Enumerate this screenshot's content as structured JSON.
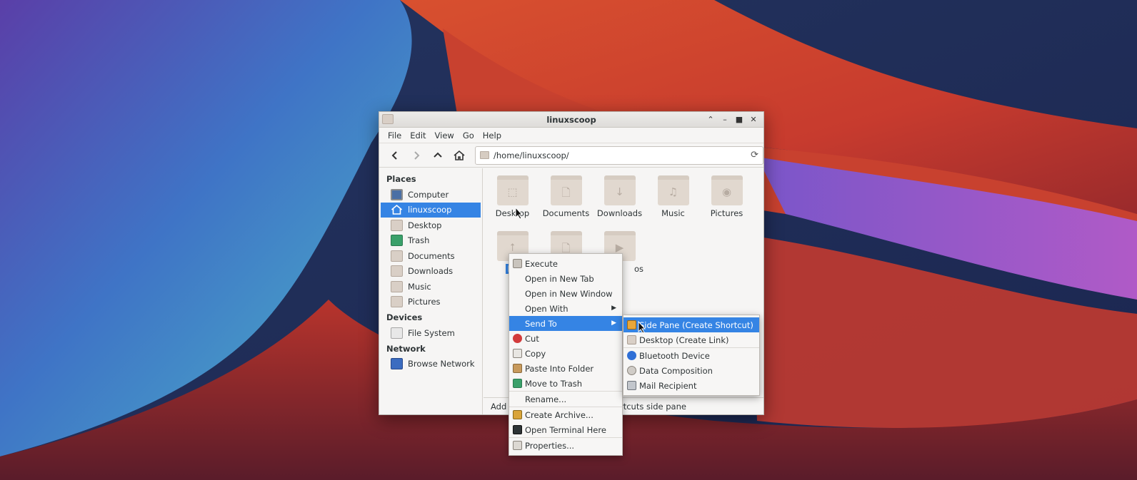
{
  "window": {
    "title": "linuxscoop",
    "controls": [
      "chevron-up-icon",
      "minimize-icon",
      "maximize-icon",
      "close-icon"
    ]
  },
  "menubar": {
    "items": [
      "File",
      "Edit",
      "View",
      "Go",
      "Help"
    ]
  },
  "toolbar": {
    "path": "/home/linuxscoop/"
  },
  "sidebar": {
    "places_heading": "Places",
    "places": [
      {
        "label": "Computer",
        "icon": "computer-icon"
      },
      {
        "label": "linuxscoop",
        "icon": "home-icon",
        "active": true
      },
      {
        "label": "Desktop",
        "icon": "folder-icon"
      },
      {
        "label": "Trash",
        "icon": "trash-icon"
      },
      {
        "label": "Documents",
        "icon": "folder-icon"
      },
      {
        "label": "Downloads",
        "icon": "folder-icon"
      },
      {
        "label": "Music",
        "icon": "folder-icon"
      },
      {
        "label": "Pictures",
        "icon": "folder-icon"
      }
    ],
    "devices_heading": "Devices",
    "devices": [
      {
        "label": "File System",
        "icon": "drive-icon"
      }
    ],
    "network_heading": "Network",
    "network": [
      {
        "label": "Browse Network",
        "icon": "network-icon"
      }
    ]
  },
  "files": [
    {
      "label": "Desktop"
    },
    {
      "label": "Documents"
    },
    {
      "label": "Downloads"
    },
    {
      "label": "Music"
    },
    {
      "label": "Pictures"
    },
    {
      "label": "Pu"
    },
    {
      "label": ""
    },
    {
      "label": "os"
    }
  ],
  "statusbar": {
    "left": "Add",
    "right": "rtcuts side pane"
  },
  "context_menu": {
    "items": [
      {
        "label": "Execute",
        "icon": "gears-icon"
      },
      {
        "label": "Open in New Tab"
      },
      {
        "label": "Open in New Window"
      },
      {
        "label": "Open With",
        "submenu": true
      },
      {
        "label": "Send To",
        "submenu": true,
        "highlighted": true
      },
      {
        "label": "Cut",
        "icon": "scissors-icon"
      },
      {
        "label": "Copy",
        "icon": "copy-icon"
      },
      {
        "label": "Paste Into Folder",
        "icon": "paste-icon"
      },
      {
        "label": "Move to Trash",
        "icon": "trash-icon"
      },
      {
        "label": "Rename..."
      },
      {
        "label": "Create Archive...",
        "icon": "archive-icon"
      },
      {
        "label": "Open Terminal Here",
        "icon": "terminal-icon"
      },
      {
        "label": "Properties...",
        "icon": "properties-icon"
      }
    ]
  },
  "send_to_menu": {
    "items": [
      {
        "label": "Side Pane (Create Shortcut)",
        "highlighted": true
      },
      {
        "label": "Desktop (Create Link)"
      },
      {
        "label": "Bluetooth Device"
      },
      {
        "label": "Data Composition"
      },
      {
        "label": "Mail Recipient"
      }
    ]
  },
  "colors": {
    "accent": "#3584e4",
    "window_bg": "#f6f5f4"
  }
}
